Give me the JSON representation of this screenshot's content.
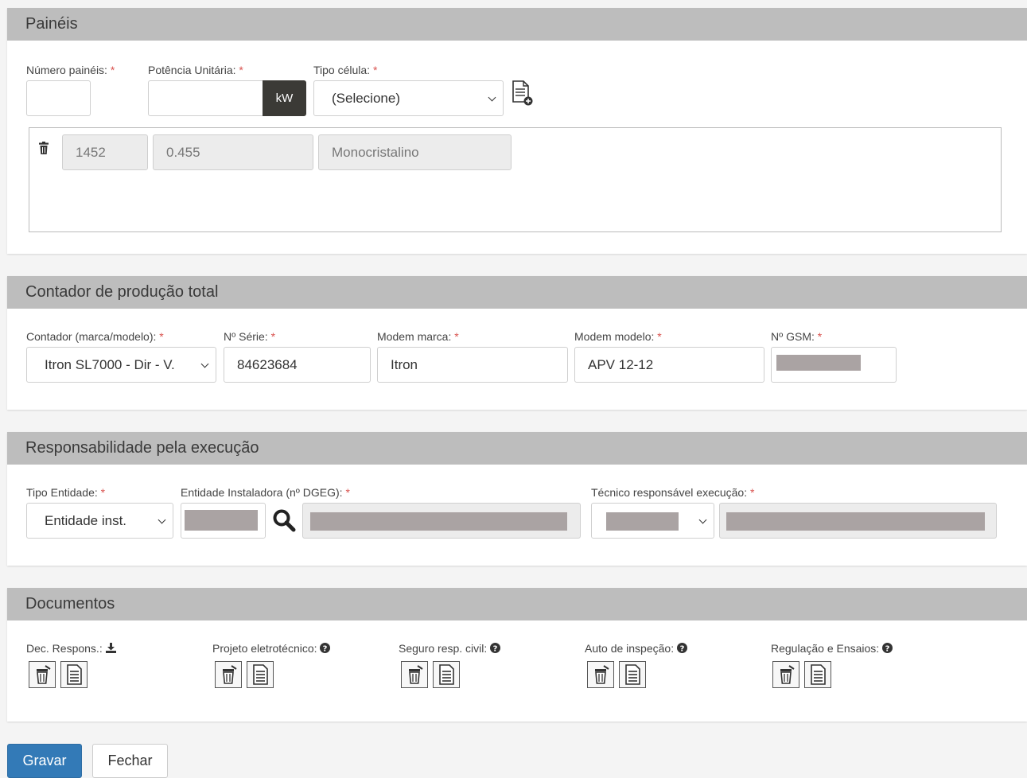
{
  "paineis": {
    "title": "Painéis",
    "num_label": "Número painéis:",
    "pot_label": "Potência Unitária:",
    "pot_unit": "kW",
    "tipo_label": "Tipo célula:",
    "tipo_value": "(Selecione)",
    "row": {
      "num": "1452",
      "pot": "0.455",
      "tipo": "Monocristalino"
    }
  },
  "contador": {
    "title": "Contador de produção total",
    "marca_label": "Contador (marca/modelo):",
    "marca_value": "Itron SL7000 - Dir - V.",
    "serie_label": "Nº Série:",
    "serie_value": "84623684",
    "modem_marca_label": "Modem marca:",
    "modem_marca_value": "Itron",
    "modem_modelo_label": "Modem modelo:",
    "modem_modelo_value": "APV 12-12",
    "gsm_label": "Nº GSM:"
  },
  "resp": {
    "title": "Responsabilidade pela execução",
    "tipo_label": "Tipo Entidade:",
    "tipo_value": "Entidade inst.",
    "entidade_label": "Entidade Instaladora (nº DGEG):",
    "tecnico_label": "Técnico responsável execução:"
  },
  "docs": {
    "title": "Documentos",
    "items": [
      {
        "label": "Dec. Respons.:",
        "icon": "download-icon"
      },
      {
        "label": "Projeto eletrotécnico:",
        "icon": "help-icon"
      },
      {
        "label": "Seguro resp. civil:",
        "icon": "help-icon"
      },
      {
        "label": "Auto de inspeção:",
        "icon": "help-icon"
      },
      {
        "label": "Regulação e Ensaios:",
        "icon": "help-icon"
      }
    ]
  },
  "required_mark": "*",
  "buttons": {
    "save": "Gravar",
    "close": "Fechar"
  },
  "colors": {
    "primary": "#337ab7",
    "header": "#bdbdbd",
    "required": "#d9534f"
  }
}
